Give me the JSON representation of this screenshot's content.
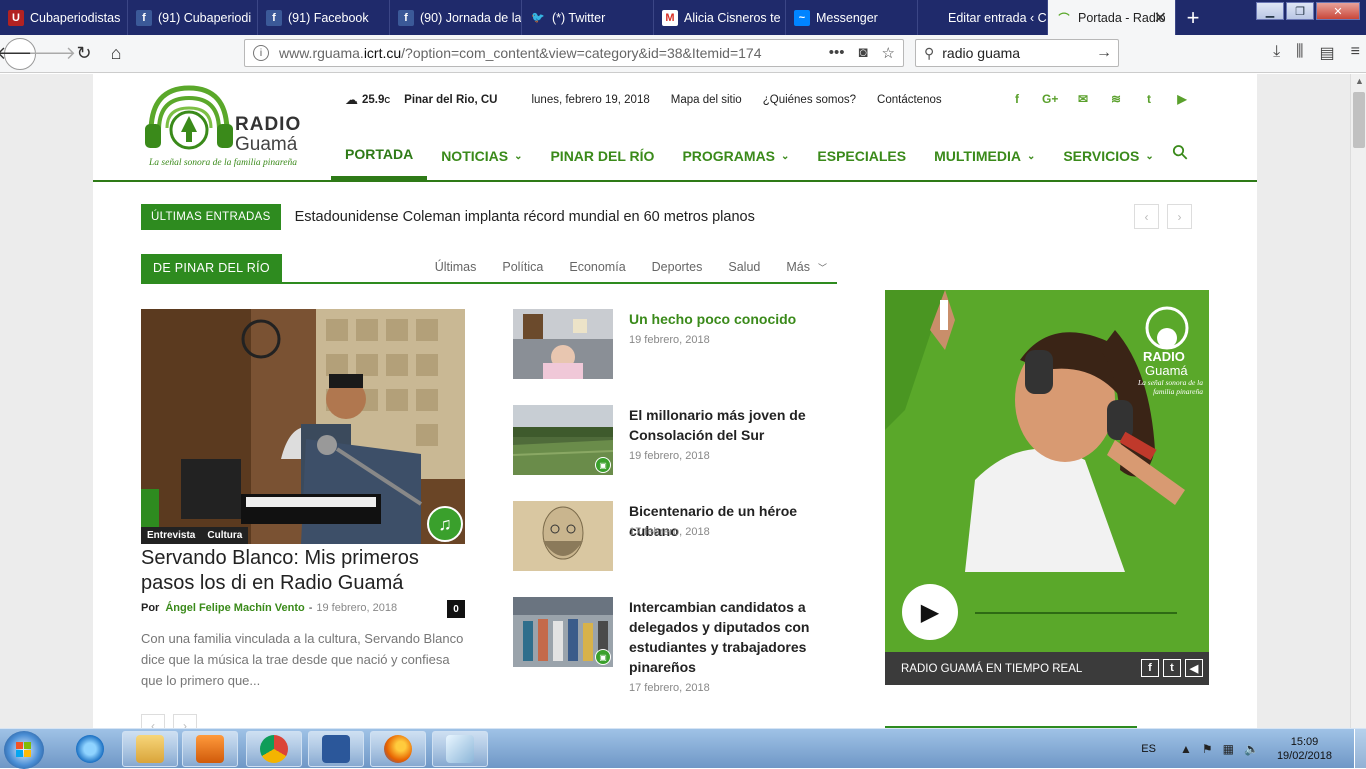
{
  "browser": {
    "tabs": [
      {
        "label": "Cubaperiodistas",
        "icon": "cubaperiodistas-icon",
        "width": 128
      },
      {
        "label": "(91) Cubaperiodi",
        "icon": "facebook-icon",
        "width": 130
      },
      {
        "label": "(91) Facebook",
        "icon": "facebook-icon",
        "width": 132
      },
      {
        "label": "(90) Jornada de la",
        "icon": "facebook-icon",
        "width": 132
      },
      {
        "label": "(*) Twitter",
        "icon": "twitter-icon",
        "width": 132
      },
      {
        "label": "Alicia Cisneros te",
        "icon": "gmail-icon",
        "width": 132
      },
      {
        "label": "Messenger",
        "icon": "messenger-icon",
        "width": 132
      },
      {
        "label": "Editar entrada ‹ Cuba",
        "icon": "blank-icon",
        "width": 130
      },
      {
        "label": "Portada - Radio",
        "icon": "radio-guama-icon",
        "width": 128,
        "active": true
      }
    ],
    "new_tab": "+",
    "url_prefix": "www.rguama.",
    "url_domain": "icrt.cu",
    "url_path": "/?option=com_content&view=category&id=38&Itemid=174",
    "search_value": "radio guama"
  },
  "site": {
    "logo_radio": "RADIO",
    "logo_guama": "Guamá",
    "logo_slogan": "La señal sonora de la familia pinareña",
    "weather_temp": "25.9",
    "weather_unit": "C",
    "weather_city": "Pinar del Rio, CU",
    "date": "lunes, febrero 19, 2018",
    "top_links": [
      "Mapa del sitio",
      "¿Quiénes somos?",
      "Contáctenos"
    ],
    "social": [
      "f",
      "G+",
      "✉",
      "≋",
      "t",
      "▶"
    ],
    "nav": [
      {
        "label": "PORTADA",
        "dropdown": false,
        "active": true
      },
      {
        "label": "NOTICIAS",
        "dropdown": true
      },
      {
        "label": "PINAR DEL RÍO",
        "dropdown": false
      },
      {
        "label": "PROGRAMAS",
        "dropdown": true
      },
      {
        "label": "ESPECIALES",
        "dropdown": false
      },
      {
        "label": "MULTIMEDIA",
        "dropdown": true
      },
      {
        "label": "SERVICIOS",
        "dropdown": true
      }
    ],
    "ticker_label": "ÚLTIMAS ENTRADAS",
    "ticker_text": "Estadounidense Coleman implanta récord mundial en 60 metros planos",
    "block_title": "DE PINAR DEL RÍO",
    "block_filters": [
      "Últimas",
      "Política",
      "Economía",
      "Deportes",
      "Salud",
      "Más"
    ],
    "featured": {
      "tags": [
        "Entrevista",
        "Cultura"
      ],
      "title": "Servando Blanco: Mis primeros pasos los di en Radio Guamá",
      "by": "Por",
      "author": "Ángel Felipe Machín Vento",
      "date": "19 febrero, 2018",
      "comments": "0",
      "excerpt": "Con una familia vinculada a la cultura, Servando Blanco dice que la música la trae desde que nació y confiesa que lo primero que..."
    },
    "articles": [
      {
        "title": "Un hecho poco conocido",
        "date": "19 febrero, 2018",
        "highlight": true
      },
      {
        "title": "El millonario más joven de Consolación del Sur",
        "date": "19 febrero, 2018"
      },
      {
        "title": "Bicentenario de un héroe cubano",
        "date": "17 febrero, 2018"
      },
      {
        "title": "Intercambian candidatos a delegados y diputados con estudiantes y trabajadores pinareños",
        "date": "17 febrero, 2018"
      }
    ],
    "player_title": "RADIO GUAMÁ EN TIEMPO REAL",
    "player_logo_radio": "RADIO",
    "player_logo_guama": "Guamá",
    "player_logo_slogan": "La señal sonora de la familia pinareña"
  },
  "taskbar": {
    "lang": "ES",
    "time": "15:09",
    "date": "19/02/2018"
  },
  "colors": {
    "brand_green": "#2e8b1f",
    "link_green": "#3a8a1a",
    "tab_bar": "#1f2a6b"
  }
}
